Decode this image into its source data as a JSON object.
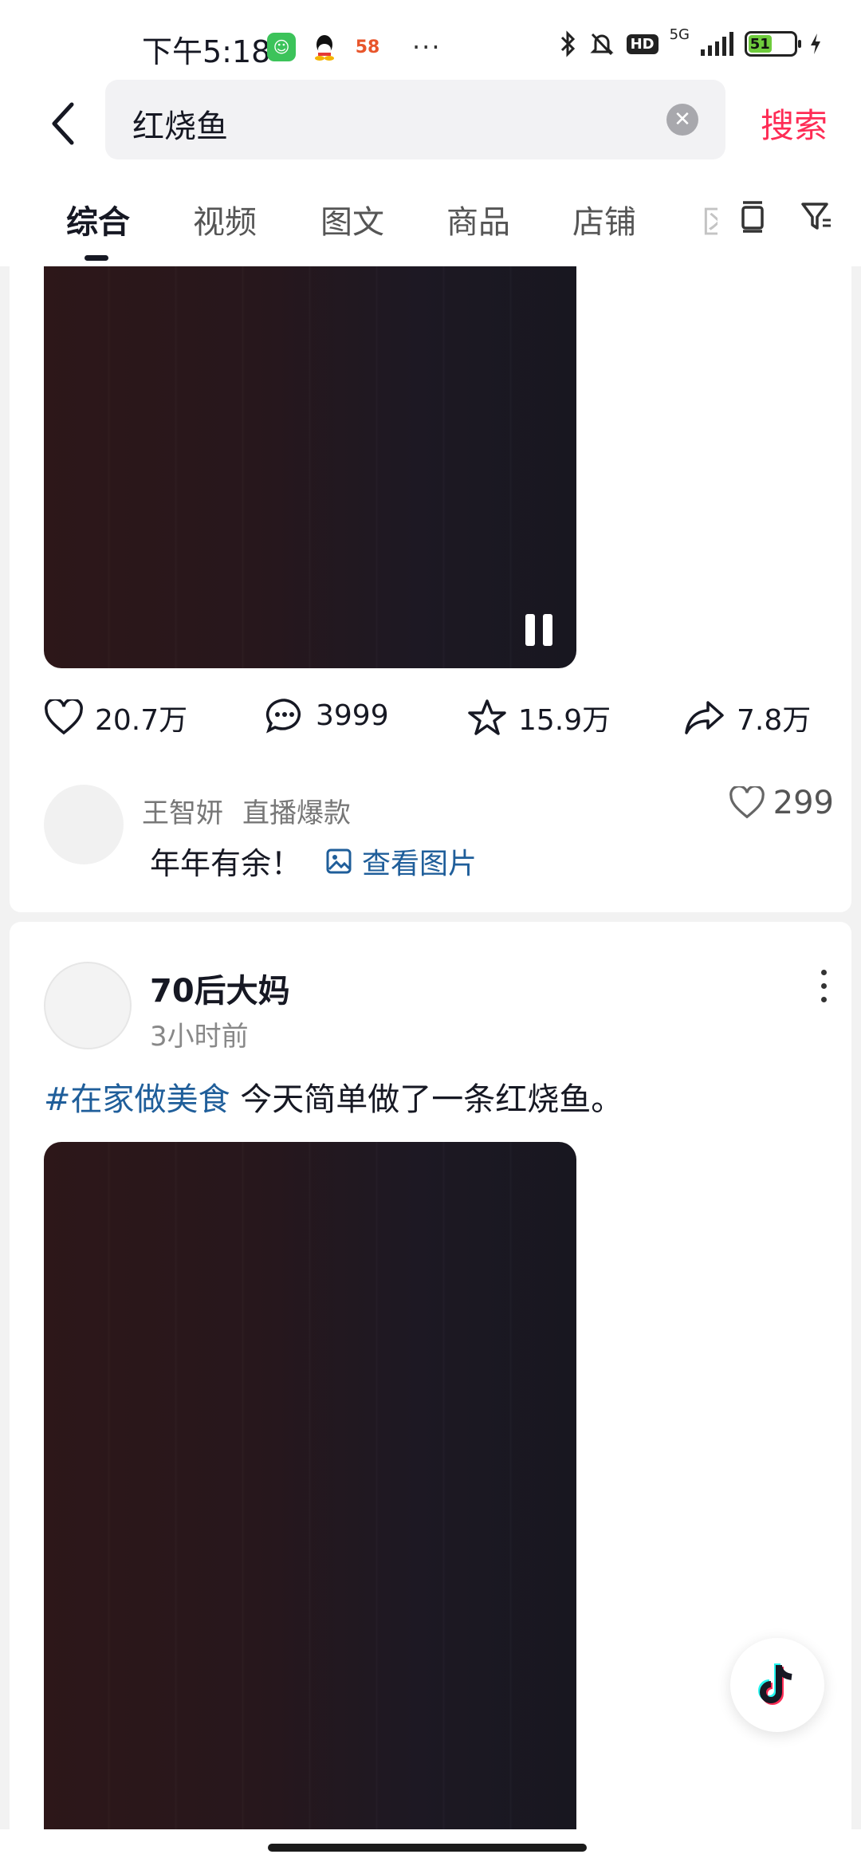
{
  "status_bar": {
    "time": "下午5:18",
    "more": "···",
    "network": "5G",
    "hd": "HD",
    "battery": "51"
  },
  "search": {
    "query": "红烧鱼",
    "submit_label": "搜索"
  },
  "tabs": [
    {
      "label": "综合",
      "active": true
    },
    {
      "label": "视频",
      "active": false
    },
    {
      "label": "图文",
      "active": false
    },
    {
      "label": "商品",
      "active": false
    },
    {
      "label": "店铺",
      "active": false
    },
    {
      "label": "区",
      "active": false
    }
  ],
  "post1": {
    "likes": "20.7万",
    "comments": "3999",
    "favorites": "15.9万",
    "shares": "7.8万",
    "top_comment": {
      "user": "王智妍",
      "tag": "直播爆款",
      "text": "年年有余！",
      "view_images": "查看图片",
      "likes": "299"
    }
  },
  "post2": {
    "author": "70后大妈",
    "time": "3小时前",
    "hashtag": "#在家做美食",
    "caption": " 今天简单做了一条红烧鱼。"
  },
  "colors": {
    "accent": "#fe2c55",
    "link": "#1f5e9a",
    "text": "#161823"
  }
}
